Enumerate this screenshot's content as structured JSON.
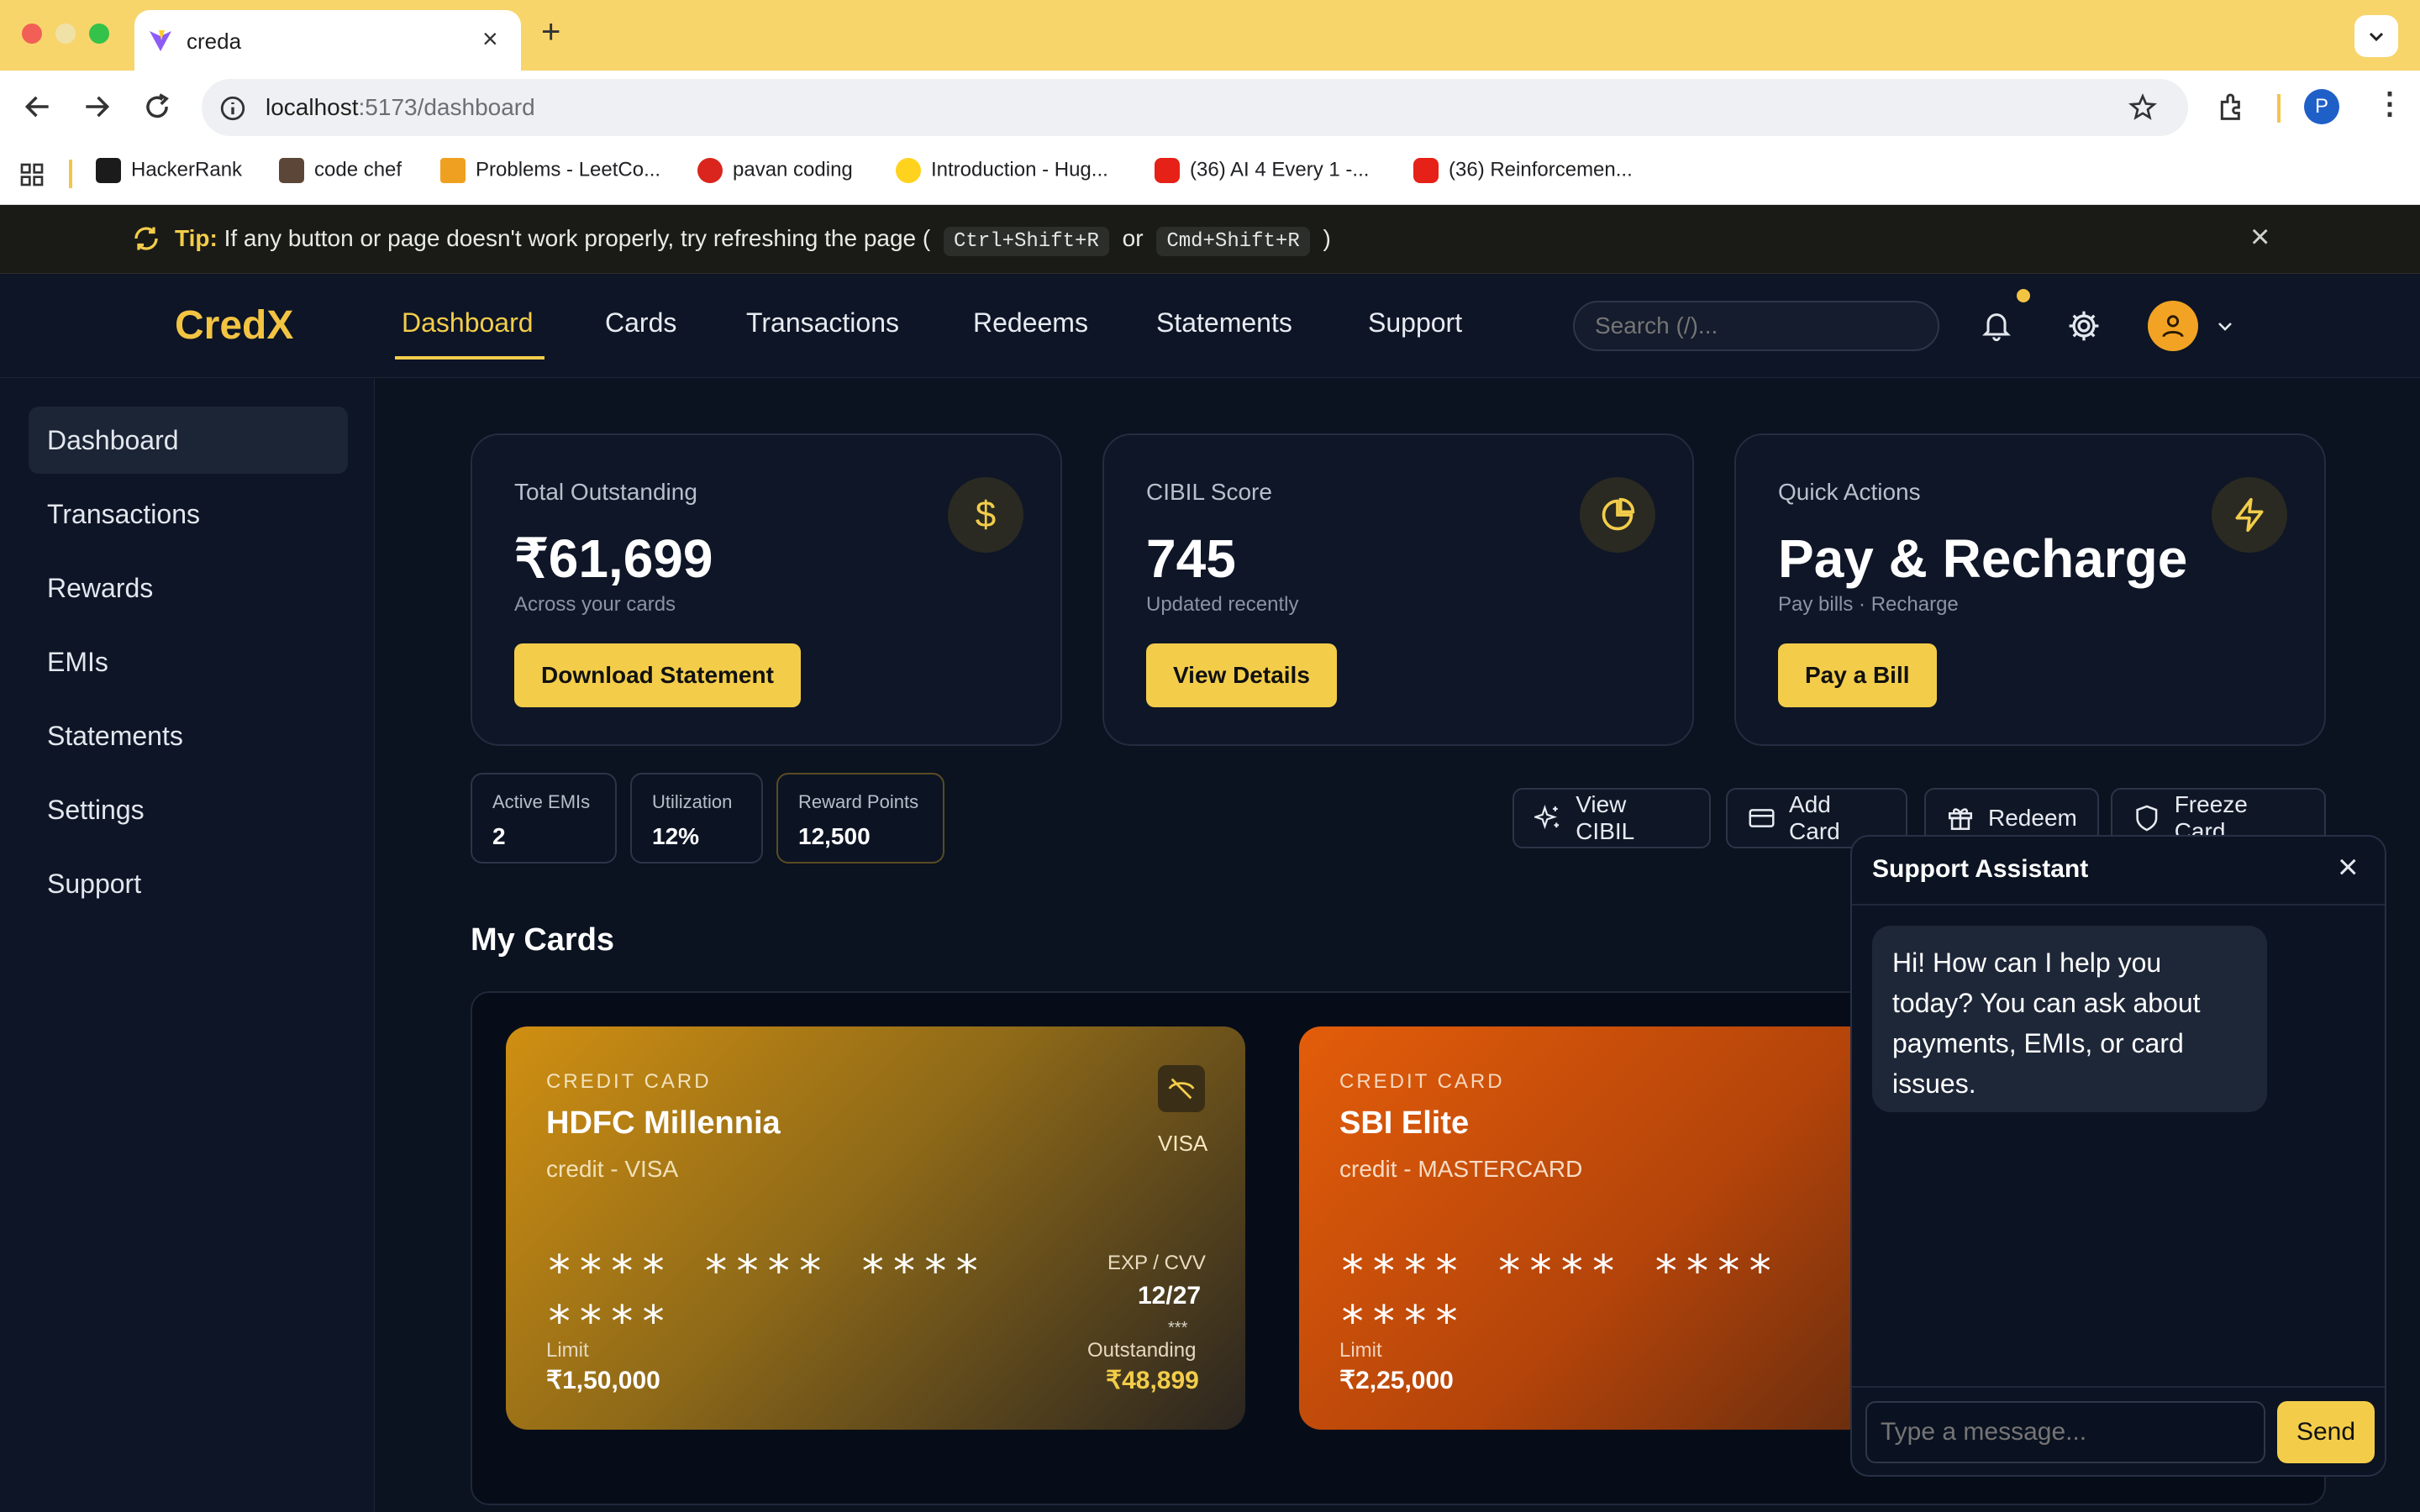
{
  "browser": {
    "tab_title": "creda",
    "url_host": "localhost",
    "url_rest": ":5173/dashboard",
    "bookmarks": [
      "HackerRank",
      "code chef",
      "Problems - LeetCo...",
      "pavan coding",
      "Introduction - Hug...",
      "(36) AI 4 Every 1 -...",
      "(36) Reinforcemen..."
    ],
    "profile_initial": "P"
  },
  "tip": {
    "label": "Tip:",
    "text": "If any button or page doesn't work properly, try refreshing the page (",
    "key1": "Ctrl+Shift+R",
    "or": "or",
    "key2": "Cmd+Shift+R",
    "close": ")"
  },
  "nav": {
    "logo": "CredX",
    "links": [
      "Dashboard",
      "Cards",
      "Transactions",
      "Redeems",
      "Statements",
      "Support"
    ],
    "search_placeholder": "Search (/)..."
  },
  "sidebar": {
    "items": [
      "Dashboard",
      "Transactions",
      "Rewards",
      "EMIs",
      "Statements",
      "Settings",
      "Support"
    ]
  },
  "stats": [
    {
      "label": "Total Outstanding",
      "value": "₹61,699",
      "sub": "Across your cards",
      "button": "Download Statement"
    },
    {
      "label": "CIBIL Score",
      "value": "745",
      "sub": "Updated recently",
      "button": "View Details"
    },
    {
      "label": "Quick Actions",
      "value": "Pay & Recharge",
      "sub": "Pay bills · Recharge",
      "button": "Pay a Bill"
    }
  ],
  "mini": [
    {
      "label": "Active EMIs",
      "value": "2"
    },
    {
      "label": "Utilization",
      "value": "12%"
    },
    {
      "label": "Reward Points",
      "value": "12,500"
    }
  ],
  "actions": [
    "View CIBIL",
    "Add Card",
    "Redeem",
    "Freeze Card"
  ],
  "cards_section": {
    "title": "My Cards",
    "cards": [
      {
        "type": "CREDIT CARD",
        "name": "HDFC Millennia",
        "sub": "credit - VISA",
        "network": "VISA",
        "number_line1": "**** **** ****",
        "number_line2": "****",
        "exp_label": "EXP / CVV",
        "exp": "12/27",
        "cvv": "***",
        "limit_label": "Limit",
        "limit": "₹1,50,000",
        "outstanding_label": "Outstanding",
        "outstanding": "₹48,899"
      },
      {
        "type": "CREDIT CARD",
        "name": "SBI Elite",
        "sub": "credit - MASTERCARD",
        "number_line1": "**** **** ****",
        "number_line2": "****",
        "limit_label": "Limit",
        "limit": "₹2,25,000"
      }
    ]
  },
  "chat": {
    "title": "Support Assistant",
    "message": "Hi! How can I help you today? You can ask about payments, EMIs, or card issues.",
    "input_placeholder": "Type a message...",
    "send": "Send"
  },
  "colors": {
    "accent": "#f3cd4a",
    "bg": "#0b1220",
    "card1": "#c98a14",
    "card2": "#d7580f"
  }
}
